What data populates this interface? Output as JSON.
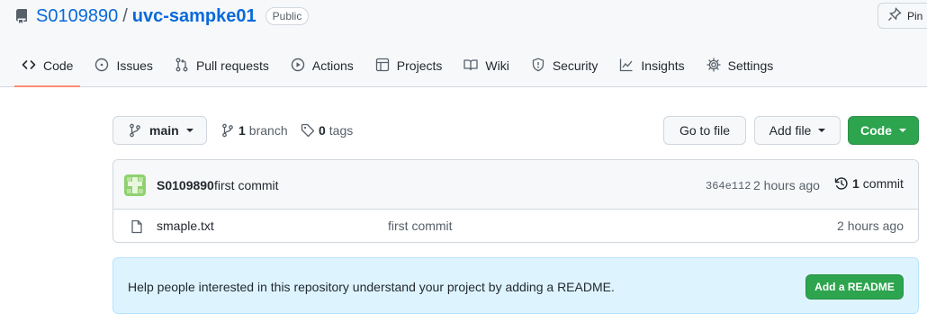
{
  "repo": {
    "owner": "S0109890",
    "separator": "/",
    "name": "uvc-sampke01",
    "visibility": "Public",
    "icon": "repo-icon"
  },
  "header_actions": {
    "pin_label": "Pin",
    "pin_icon": "pin-icon"
  },
  "tabs": [
    {
      "label": "Code",
      "icon": "code-icon",
      "active": true
    },
    {
      "label": "Issues",
      "icon": "issue-icon"
    },
    {
      "label": "Pull requests",
      "icon": "pull-request-icon"
    },
    {
      "label": "Actions",
      "icon": "play-icon"
    },
    {
      "label": "Projects",
      "icon": "table-icon"
    },
    {
      "label": "Wiki",
      "icon": "book-icon"
    },
    {
      "label": "Security",
      "icon": "shield-icon"
    },
    {
      "label": "Insights",
      "icon": "graph-icon"
    },
    {
      "label": "Settings",
      "icon": "gear-icon"
    }
  ],
  "file_nav": {
    "branch": "main",
    "branch_count": "1",
    "branch_label": "branch",
    "tag_count": "0",
    "tag_label": "tags",
    "go_to_file": "Go to file",
    "add_file": "Add file",
    "code": "Code"
  },
  "latest_commit": {
    "author": "S0109890",
    "message": "first commit",
    "sha": "364e112",
    "age": "2 hours ago",
    "commit_count": "1",
    "commit_label": "commit"
  },
  "files": [
    {
      "name": "smaple.txt",
      "commit_message": "first commit",
      "age": "2 hours ago"
    }
  ],
  "readme_banner": {
    "text": "Help people interested in this repository understand your project by adding a README.",
    "button": "Add a README"
  },
  "colors": {
    "accent_link": "#0969da",
    "active_tab_underline": "#fd8c73",
    "primary_button": "#2da44e",
    "banner_bg": "#ddf4ff"
  }
}
